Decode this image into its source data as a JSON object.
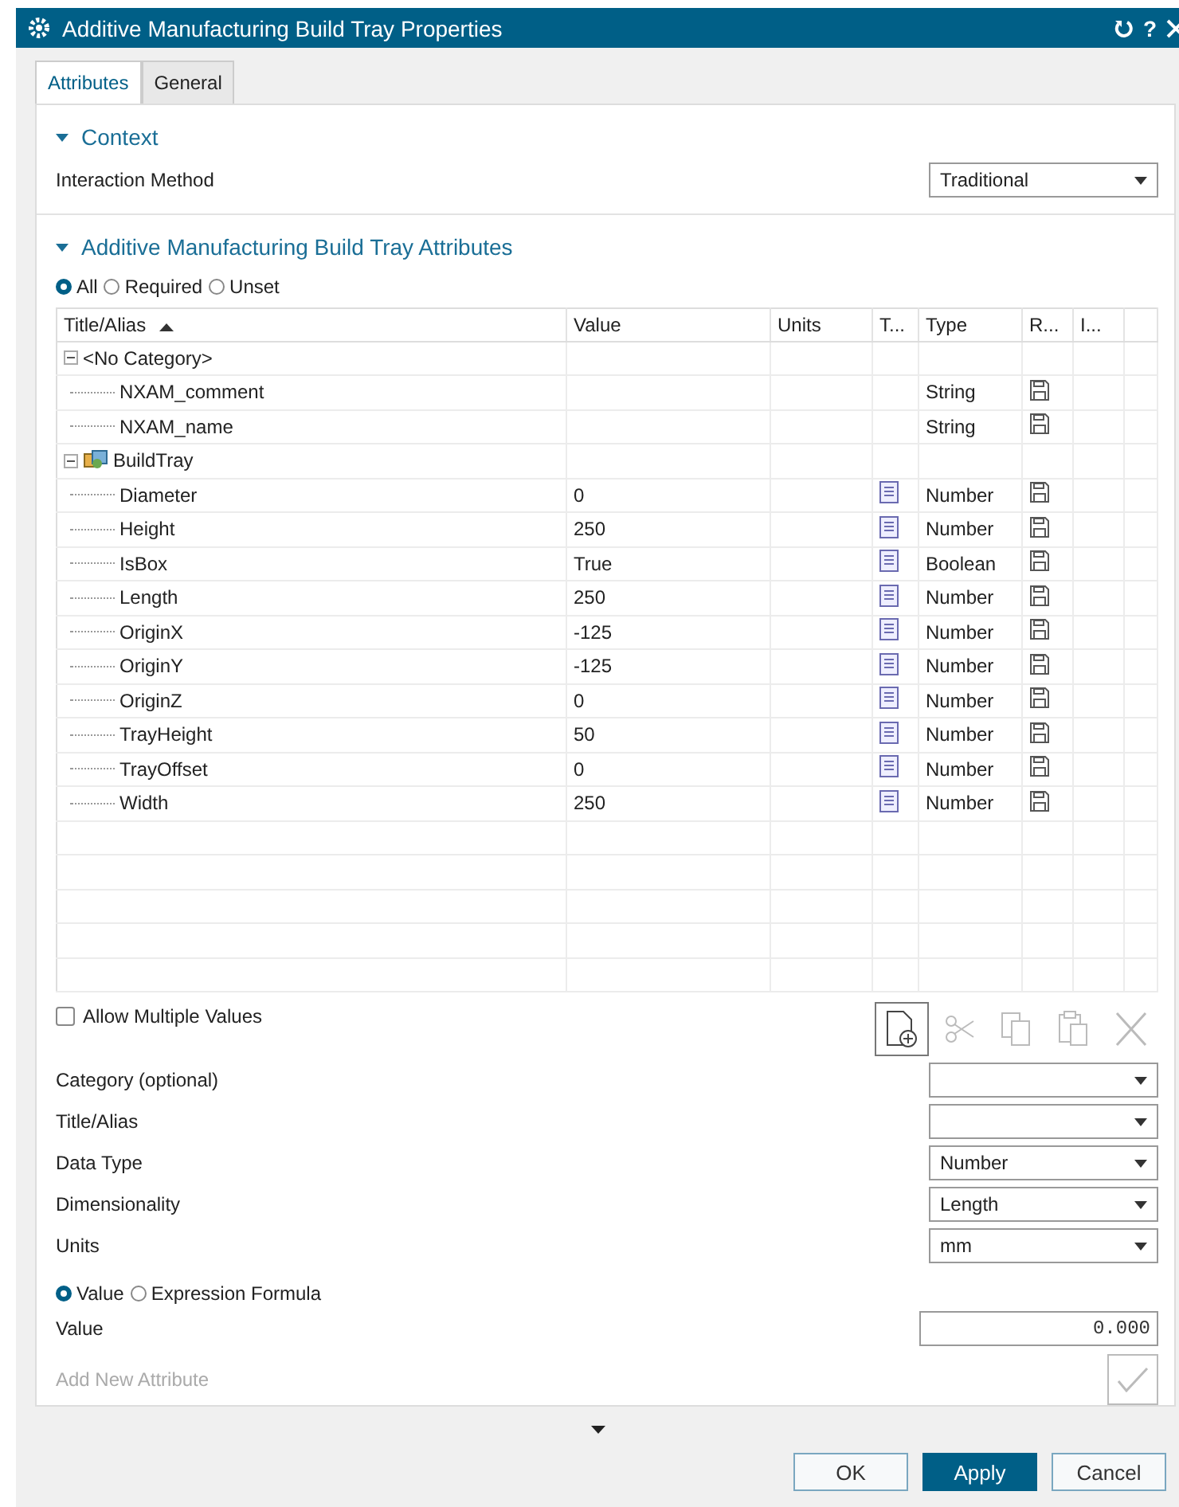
{
  "window": {
    "title": "Additive Manufacturing Build Tray Properties",
    "help": "?"
  },
  "tabs": [
    {
      "label": "Attributes",
      "selected": true
    },
    {
      "label": "General",
      "selected": false
    }
  ],
  "context": {
    "title": "Context",
    "expanded": true,
    "fields": [
      {
        "label": "Interaction Method",
        "kind": "dropdown",
        "value": "Traditional"
      }
    ]
  },
  "attributes_section": {
    "title": "Additive Manufacturing Build Tray Attributes",
    "expanded": true,
    "filter": [
      {
        "label": "All",
        "selected": true
      },
      {
        "label": "Required",
        "selected": false
      },
      {
        "label": "Unset",
        "selected": false
      }
    ],
    "table": {
      "columns": [
        "Title/Alias",
        "Value",
        "Units",
        "T...",
        "Type",
        "R...",
        "I..."
      ],
      "rows": [
        {
          "title": "<No Category>",
          "kind": "category",
          "expanded": true,
          "children": [
            {
              "title": "NXAM_comment",
              "type": "String",
              "t_icon": false
            },
            {
              "title": "NXAM_name",
              "type": "String",
              "t_icon": false
            }
          ]
        },
        {
          "title": "BuildTray",
          "kind": "class",
          "expanded": true,
          "children": [
            {
              "title": "Diameter",
              "value": "0",
              "type": "Number",
              "t_icon": true
            },
            {
              "title": "Height",
              "value": "250",
              "type": "Number",
              "t_icon": true
            },
            {
              "title": "IsBox",
              "value": "True",
              "type": "Boolean",
              "t_icon": true
            },
            {
              "title": "Length",
              "value": "250",
              "type": "Number",
              "t_icon": true
            },
            {
              "title": "OriginX",
              "value": "-125",
              "type": "Number",
              "t_icon": true
            },
            {
              "title": "OriginY",
              "value": "-125",
              "type": "Number",
              "t_icon": true
            },
            {
              "title": "OriginZ",
              "value": "0",
              "type": "Number",
              "t_icon": true
            },
            {
              "title": "TrayHeight",
              "value": "50",
              "type": "Number",
              "t_icon": true
            },
            {
              "title": "TrayOffset",
              "value": "0",
              "type": "Number",
              "t_icon": true
            },
            {
              "title": "Width",
              "value": "250",
              "type": "Number",
              "t_icon": true
            }
          ]
        }
      ]
    },
    "allow_multiple": {
      "label": "Allow Multiple Values",
      "checked": false
    },
    "toolbar": [
      {
        "kind": "new",
        "disabled": false
      },
      {
        "kind": "cut",
        "disabled": true
      },
      {
        "kind": "copy",
        "disabled": true
      },
      {
        "kind": "paste",
        "disabled": true
      },
      {
        "kind": "delete",
        "disabled": true
      }
    ],
    "fields": [
      {
        "label": "Category (optional)",
        "kind": "dropdown"
      },
      {
        "label": "Title/Alias",
        "kind": "dropdown"
      },
      {
        "label": "Data Type",
        "kind": "dropdown",
        "value": "Number"
      },
      {
        "label": "Dimensionality",
        "kind": "dropdown",
        "value": "Length"
      },
      {
        "label": "Units",
        "kind": "dropdown",
        "value": "mm"
      }
    ],
    "value_mode": [
      {
        "label": "Value",
        "selected": true
      },
      {
        "label": "Expression Formula",
        "selected": false
      }
    ],
    "value_field": {
      "label": "Value",
      "value": "0.000"
    },
    "add": {
      "label": "Add New Attribute",
      "disabled": true
    }
  },
  "buttons": [
    {
      "label": "OK",
      "primary": false
    },
    {
      "label": "Apply",
      "primary": true
    },
    {
      "label": "Cancel",
      "primary": false
    }
  ]
}
